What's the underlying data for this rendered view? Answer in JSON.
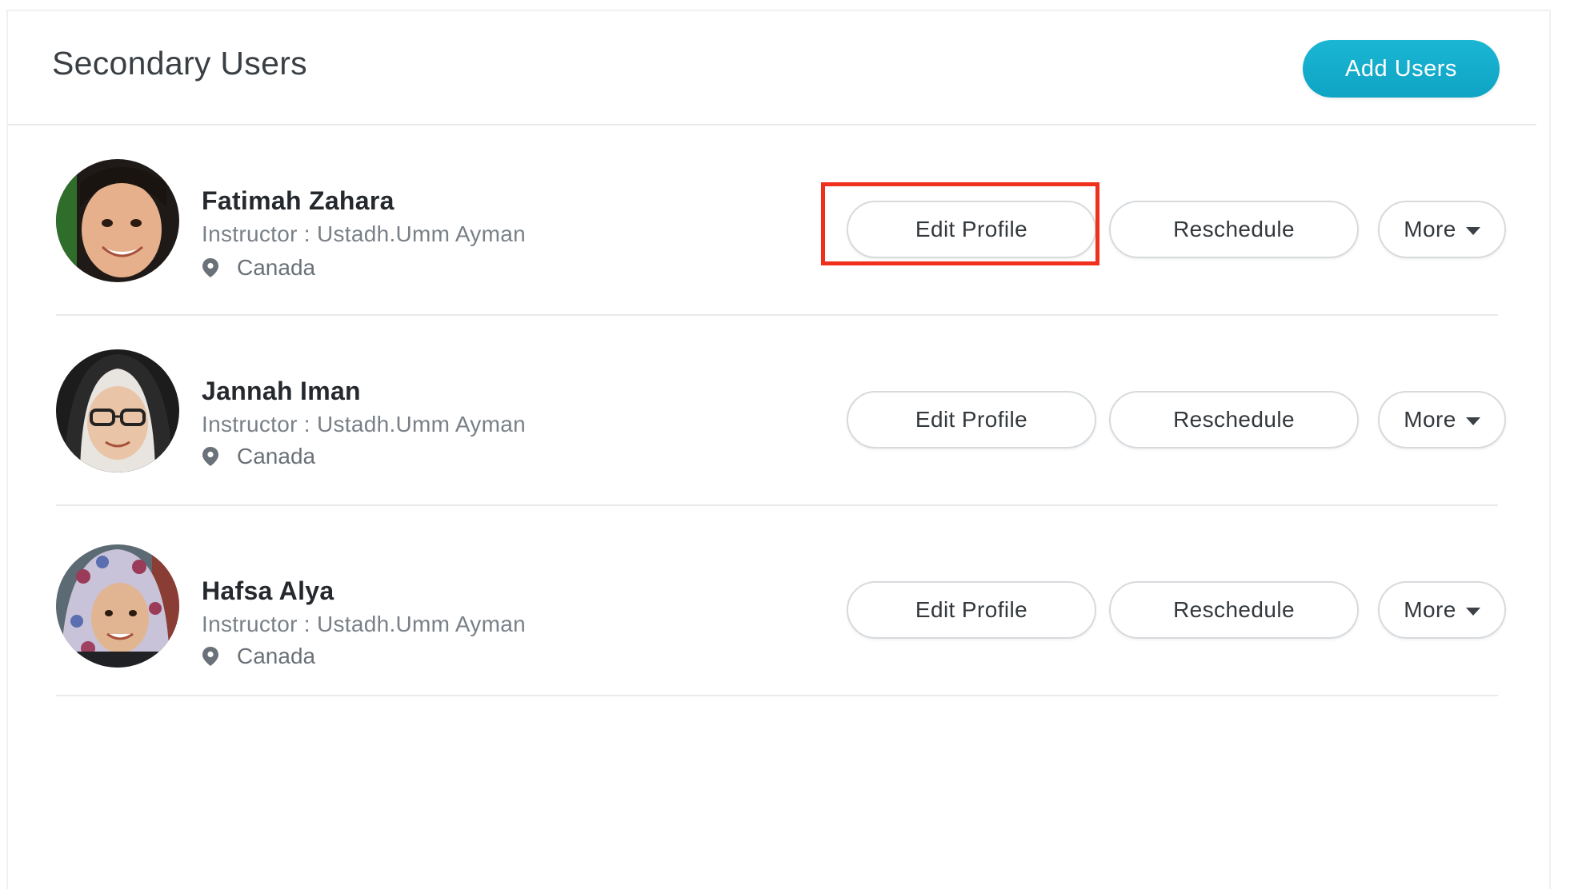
{
  "header": {
    "title": "Secondary Users",
    "add_users_label": "Add Users"
  },
  "accent_color": "#14acd0",
  "highlight_color": "#f0301c",
  "users": [
    {
      "name": "Fatimah Zahara",
      "instructor": "Instructor : Ustadh.Umm Ayman",
      "location": "Canada",
      "edit_label": "Edit Profile",
      "reschedule_label": "Reschedule",
      "more_label": "More"
    },
    {
      "name": "Jannah Iman",
      "instructor": "Instructor : Ustadh.Umm Ayman",
      "location": "Canada",
      "edit_label": "Edit Profile",
      "reschedule_label": "Reschedule",
      "more_label": "More"
    },
    {
      "name": "Hafsa Alya",
      "instructor": "Instructor : Ustadh.Umm Ayman",
      "location": "Canada",
      "edit_label": "Edit Profile",
      "reschedule_label": "Reschedule",
      "more_label": "More"
    }
  ],
  "icons": {
    "location": "map-pin-icon",
    "more_dropdown": "caret-down-icon"
  }
}
